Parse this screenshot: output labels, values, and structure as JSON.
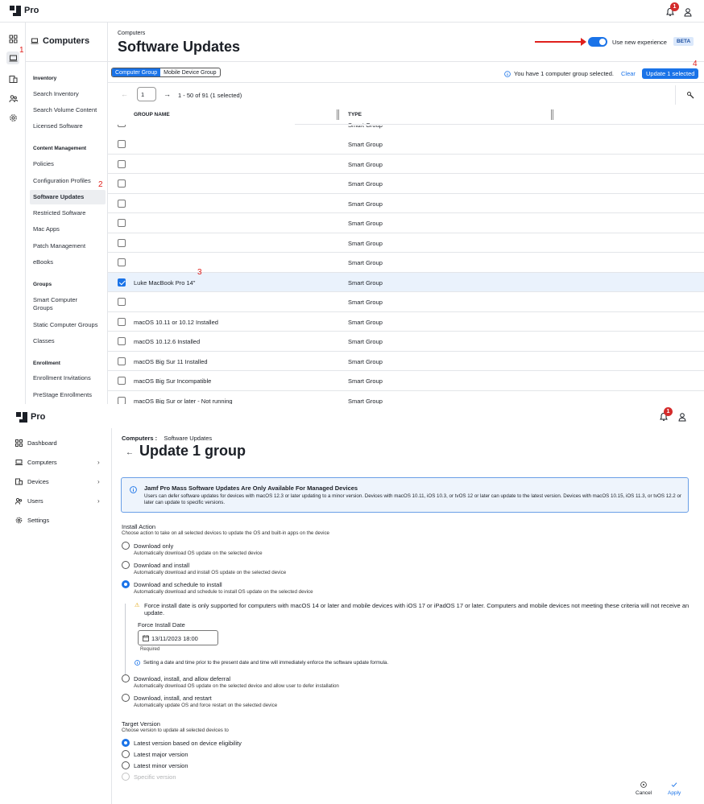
{
  "top": {
    "brand": "Pro",
    "notif_count": "1"
  },
  "rail": {
    "markers": [
      "1"
    ]
  },
  "side": {
    "title": "Computers",
    "sections": [
      {
        "title": "Inventory",
        "items": [
          "Search Inventory",
          "Search Volume Content",
          "Licensed Software"
        ]
      },
      {
        "title": "Content Management",
        "items": [
          "Policies",
          "Configuration Profiles",
          "Software Updates",
          "Restricted Software",
          "Mac Apps",
          "Patch Management",
          "eBooks"
        ]
      },
      {
        "title": "Groups",
        "items": [
          "Smart Computer Groups",
          "Static Computer Groups",
          "Classes"
        ]
      },
      {
        "title": "Enrollment",
        "items": [
          "Enrollment Invitations",
          "PreStage Enrollments"
        ]
      }
    ],
    "marker": "2"
  },
  "s1": {
    "breadcrumb": "Computers",
    "title": "Software Updates",
    "toggle_label": "Use new experience",
    "toggle_on": true,
    "beta": "BETA",
    "tabs": [
      "Computer Group",
      "Mobile Device Group"
    ],
    "selected_info": "You have 1 computer group selected.",
    "clear": "Clear",
    "update_btn": "Update 1 selected",
    "marker4": "4",
    "marker3": "3",
    "page_value": "1",
    "page_info": "1 - 50 of 91 (1 selected)",
    "columns": [
      "GROUP NAME",
      "TYPE"
    ],
    "partial_row_type": "Smart Group",
    "rows": [
      {
        "name": "",
        "type": "Smart Group",
        "checked": false
      },
      {
        "name": "",
        "type": "Smart Group",
        "checked": false
      },
      {
        "name": "",
        "type": "Smart Group",
        "checked": false
      },
      {
        "name": "",
        "type": "Smart Group",
        "checked": false
      },
      {
        "name": "",
        "type": "Smart Group",
        "checked": false
      },
      {
        "name": "",
        "type": "Smart Group",
        "checked": false
      },
      {
        "name": "",
        "type": "Smart Group",
        "checked": false
      },
      {
        "name": "Luke MacBook Pro 14\"",
        "type": "Smart Group",
        "checked": true
      },
      {
        "name": "",
        "type": "Smart Group",
        "checked": false
      },
      {
        "name": "macOS 10.11 or 10.12 Installed",
        "type": "Smart Group",
        "checked": false
      },
      {
        "name": "macOS 10.12.6 Installed",
        "type": "Smart Group",
        "checked": false
      },
      {
        "name": "macOS Big Sur 11 Installed",
        "type": "Smart Group",
        "checked": false
      },
      {
        "name": "macOS Big Sur Incompatible",
        "type": "Smart Group",
        "checked": false
      },
      {
        "name": "macOS Big Sur or later - Not running",
        "type": "Smart Group",
        "checked": false
      }
    ]
  },
  "s2": {
    "nav": [
      {
        "label": "Dashboard",
        "chev": false
      },
      {
        "label": "Computers",
        "chev": true
      },
      {
        "label": "Devices",
        "chev": true
      },
      {
        "label": "Users",
        "chev": true
      },
      {
        "label": "Settings",
        "chev": false
      }
    ],
    "breadcrumb_parent": "Computers :",
    "breadcrumb_current": "Software Updates",
    "title": "Update 1 group",
    "alert_title": "Jamf Pro Mass Software Updates Are Only Available For Managed Devices",
    "alert_body": "Users can defer software updates for devices with macOS 12.3 or later updating to a minor version. Devices with macOS 10.11, iOS 10.3, or tvOS 12 or later can update to the latest version. Devices with macOS 10.15, iOS 11.3, or tvOS 12.2 or later can update to specific versions.",
    "install_heading": "Install Action",
    "install_sub": "Choose action to take on all selected devices to update the OS and built-in apps on the device",
    "actions": [
      {
        "label": "Download only",
        "sub": "Automatically download OS update on the selected device",
        "on": false
      },
      {
        "label": "Download and install",
        "sub": "Automatically download and install OS update on the selected device",
        "on": false
      },
      {
        "label": "Download and schedule to install",
        "sub": "Automatically download and schedule to install OS update on the selected device",
        "on": true
      },
      {
        "label": "Download, install, and allow deferral",
        "sub": "Automatically download OS update on the selected device and allow user to defer installation",
        "on": false
      },
      {
        "label": "Download, install, and restart",
        "sub": "Automatically update OS and force restart on the selected device",
        "on": false
      }
    ],
    "warning": "Force install date is only supported for computers with macOS 14 or later and mobile devices with iOS 17 or iPadOS 17 or later. Computers and mobile devices not meeting these criteria will not receive an update.",
    "force_label": "Force Install Date",
    "force_value": "13/11/2023 18:00",
    "required": "Required",
    "note": "Setting a date and time prior to the present date and time will immediately enforce the software update formula.",
    "target_heading": "Target Version",
    "target_sub": "Choose version to update all selected devices to",
    "targets": [
      {
        "label": "Latest version based on device eligibility",
        "on": true
      },
      {
        "label": "Latest major version",
        "on": false
      },
      {
        "label": "Latest minor version",
        "on": false
      },
      {
        "label": "Specific version",
        "on": false
      }
    ],
    "cancel": "Cancel",
    "apply": "Apply"
  }
}
